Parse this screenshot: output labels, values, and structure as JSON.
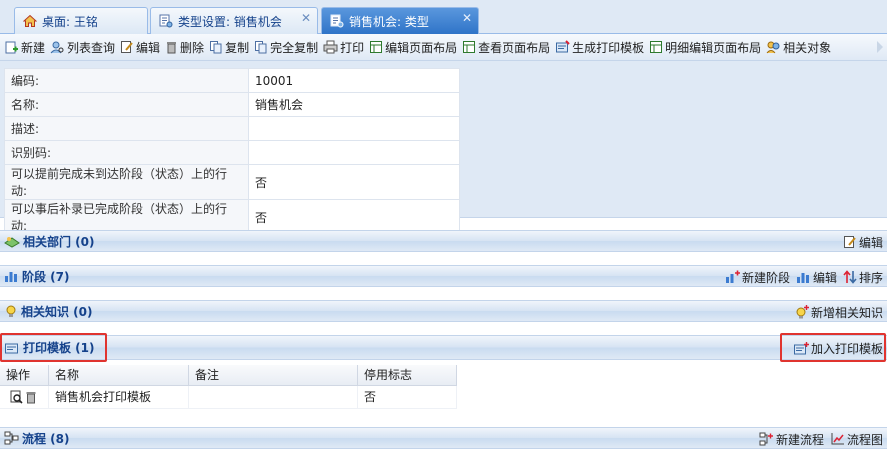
{
  "tabs": [
    {
      "label": "桌面: 王铭",
      "icon": "home-icon"
    },
    {
      "label": "类型设置: 销售机会",
      "icon": "type-settings-icon",
      "closable": true
    },
    {
      "label": "销售机会: 类型",
      "icon": "type-settings-icon",
      "closable": true,
      "active": true
    }
  ],
  "toolbar": {
    "new": "新建",
    "list_query": "列表查询",
    "edit": "编辑",
    "delete": "删除",
    "copy": "复制",
    "full_copy": "完全复制",
    "print": "打印",
    "edit_layout": "编辑页面布局",
    "view_layout": "查看页面布局",
    "gen_print_template": "生成打印模板",
    "detail_edit_layout": "明细编辑页面布局",
    "related_objects": "相关对象"
  },
  "properties": [
    {
      "label": "编码:",
      "value": "10001"
    },
    {
      "label": "名称:",
      "value": "销售机会"
    },
    {
      "label": "描述:",
      "value": ""
    },
    {
      "label": "识别码:",
      "value": ""
    },
    {
      "label": "可以提前完成未到达阶段（状态）上的行动:",
      "value": "否"
    },
    {
      "label": "可以事后补录已完成阶段（状态）上的行动:",
      "value": "否"
    }
  ],
  "sections": {
    "departments": {
      "title": "相关部门 (0)",
      "edit": "编辑"
    },
    "stages": {
      "title": "阶段 (7)",
      "new_stage": "新建阶段",
      "edit": "编辑",
      "sort": "排序"
    },
    "knowledge": {
      "title": "相关知识 (0)",
      "add_knowledge": "新增相关知识"
    },
    "print_templates": {
      "title": "打印模板 (1)",
      "add_template": "加入打印模板"
    },
    "workflows": {
      "title": "流程 (8)",
      "new_flow": "新建流程",
      "flow_chart": "流程图"
    }
  },
  "template_grid": {
    "headers": [
      "操作",
      "名称",
      "备注",
      "停用标志"
    ],
    "rows": [
      {
        "name": "销售机会打印模板",
        "note": "",
        "disabled": "否"
      }
    ]
  },
  "colors": {
    "accent": "#2f74c8",
    "highlight": "#e0342f",
    "section_title": "#15428b"
  }
}
